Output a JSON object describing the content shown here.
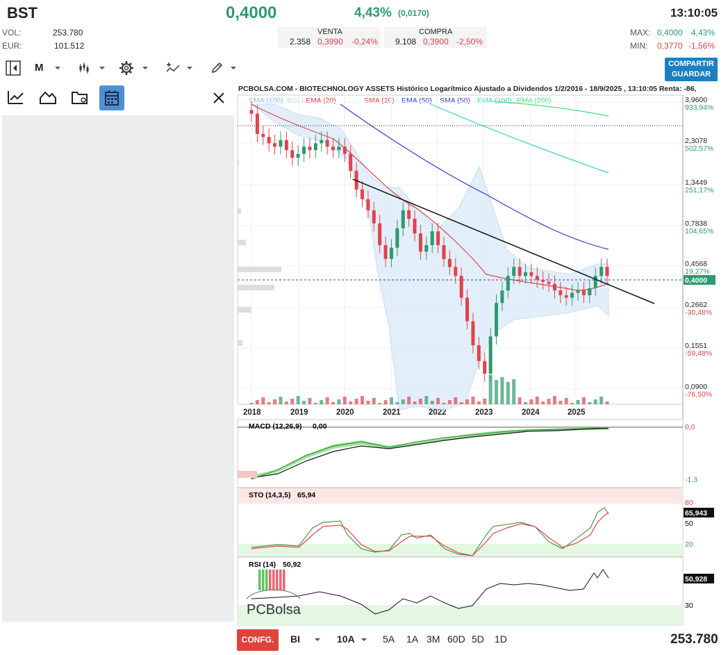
{
  "header": {
    "ticker": "BST",
    "price": "0,4000",
    "change_pct": "4,43%",
    "change_abs": "(0,0170)",
    "time": "13:10:05",
    "vol_label": "VOL:",
    "vol_value": "253.780",
    "eur_label": "EUR:",
    "eur_value": "101.512",
    "venta_label": "VENTA",
    "venta_qty": "2.358",
    "venta_price": "0,3990",
    "venta_pct": "-0,24%",
    "compra_label": "COMPRA",
    "compra_qty": "9.108",
    "compra_price": "0,3900",
    "compra_pct": "-2,50%",
    "max_label": "MAX:",
    "max_value": "0,4000",
    "max_pct": "4,43%",
    "min_label": "MIN:",
    "min_value": "0,3770",
    "min_pct": "-1,56%"
  },
  "toolbar": {
    "period": "M",
    "share_line1": "COMPARTIR",
    "share_line2": "GUARDAR"
  },
  "bottom": {
    "config": "CONFG.",
    "scale": "BI",
    "range_sel": "10A",
    "ranges": [
      "5A",
      "1A",
      "3M",
      "60D",
      "5D",
      "1D"
    ],
    "volume": "253.780"
  },
  "colors": {
    "up": "#2e9a6e",
    "down": "#e0434d",
    "accent": "#1c7fbf"
  },
  "chart_data": [
    {
      "type": "candlestick",
      "title": "PCBOLSA.COM - BIOTECHNOLOGY ASSETS Histórico Logarítmico Ajustado a Dividendos 1/2/2016 - 18/9/2025 , 13:10:05 Renta: -86,",
      "legend": [
        "SMA (100)",
        "BOLL (20)",
        "EMA (20)",
        "SMA (20)",
        "EMA (50)",
        "SMA (50)",
        "EMA (100)",
        "EMA (200)"
      ],
      "x_ticks": [
        "2018",
        "2019",
        "2020",
        "2021",
        "2022",
        "2023",
        "2024",
        "2025"
      ],
      "y_scale": "log",
      "y_ticks": [
        {
          "value": "3,9600",
          "pct": "933,94%"
        },
        {
          "value": "2,3078",
          "pct": "502,57%"
        },
        {
          "value": "1,3449",
          "pct": "251,17%"
        },
        {
          "value": "0,7838",
          "pct": "104,65%"
        },
        {
          "value": "0,4568",
          "pct": "19,27%"
        },
        {
          "value": "0,2662",
          "pct": "-30,48%"
        },
        {
          "value": "0,1551",
          "pct": "-59,48%"
        },
        {
          "value": "0,0900",
          "pct": "-76,50%"
        }
      ],
      "last_price_label": "0,4000",
      "close_series": [
        3.4,
        2.6,
        2.5,
        2.3,
        2.2,
        2.4,
        2.1,
        1.9,
        2.0,
        2.2,
        2.1,
        2.3,
        2.4,
        2.2,
        2.1,
        2.2,
        2.0,
        1.6,
        1.25,
        1.1,
        0.95,
        0.8,
        0.6,
        0.5,
        0.58,
        0.75,
        0.95,
        0.85,
        0.7,
        0.55,
        0.6,
        0.72,
        0.6,
        0.5,
        0.45,
        0.4,
        0.3,
        0.22,
        0.16,
        0.13,
        0.11,
        0.18,
        0.28,
        0.33,
        0.4,
        0.45,
        0.4,
        0.42,
        0.4,
        0.38,
        0.37,
        0.36,
        0.33,
        0.31,
        0.3,
        0.32,
        0.33,
        0.31,
        0.34,
        0.4,
        0.45,
        0.4
      ]
    },
    {
      "type": "line",
      "title": "MACD (12,26,9)",
      "value": "0,00",
      "y_ticks": [
        "0,0",
        "-1,3"
      ]
    },
    {
      "type": "line",
      "title": "STO (14,3,5)",
      "value": "65,94",
      "y_ticks": [
        "80",
        "50",
        "20"
      ],
      "last_label": "65,943"
    },
    {
      "type": "line",
      "title": "RSI (14)",
      "value": "50,92",
      "y_ticks": [
        "30"
      ],
      "last_label": "50,928"
    }
  ],
  "watermark": "PCBolsa"
}
